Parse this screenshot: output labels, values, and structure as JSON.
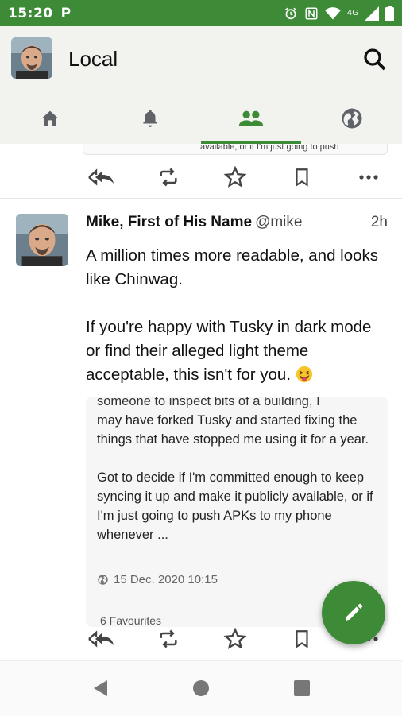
{
  "status_bar": {
    "time": "15:20",
    "network": "4G",
    "icons": [
      "parking-icon",
      "alarm-icon",
      "nfc-icon",
      "wifi-icon",
      "signal-icon",
      "battery-icon"
    ]
  },
  "app_bar": {
    "title": "Local",
    "accent_color": "#3d8b37",
    "tabs": [
      {
        "icon": "home-icon",
        "active": false
      },
      {
        "icon": "bell-icon",
        "active": false
      },
      {
        "icon": "people-icon",
        "active": true
      },
      {
        "icon": "globe-icon",
        "active": false
      }
    ]
  },
  "previous_post": {
    "card_text": "available, or if I'm just going to push"
  },
  "post": {
    "author_name": "Mike, First of His Name",
    "handle": "@mike",
    "time": "2h",
    "body_para1": "A million times more readable, and looks like Chinwag.",
    "body_para2": "If you're happy with Tusky in dark mode or find their alleged light theme acceptable, this isn't for you.",
    "emoji": "grinning-squinting-face-with-tongue",
    "quote": {
      "cut_line": "someone to inspect bits of a building, I",
      "para1": "may have forked Tusky and started fixing the things that have stopped me using it for a year.",
      "para2": "Got to decide if I'm committed enough to keep syncing it up and make it publicly available, or if I'm just going to push APKs to my phone whenever ...",
      "timestamp": "15 Dec. 2020 10:15",
      "favourites": "6 Favourites"
    }
  }
}
